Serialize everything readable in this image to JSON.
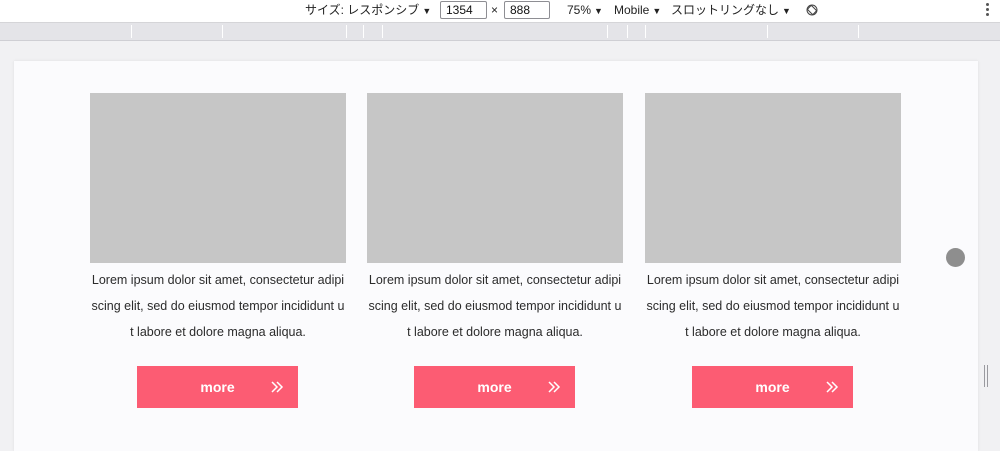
{
  "toolbar": {
    "size_label": "サイズ: レスポンシブ",
    "width_value": "1354",
    "times_sign": "×",
    "height_value": "888",
    "zoom_label": "75%",
    "device_label": "Mobile",
    "throttle_label": "スロットリングなし"
  },
  "cards": [
    {
      "text": "Lorem ipsum dolor sit amet, consectetur adipiscing elit, sed do eiusmod tempor incididunt ut labore et dolore magna aliqua.",
      "button_label": "more"
    },
    {
      "text": "Lorem ipsum dolor sit amet, consectetur adipiscing elit, sed do eiusmod tempor incididunt ut labore et dolore magna aliqua.",
      "button_label": "more"
    },
    {
      "text": "Lorem ipsum dolor sit amet, consectetur adipiscing elit, sed do eiusmod tempor incididunt ut labore et dolore magna aliqua.",
      "button_label": "more"
    }
  ],
  "icons": {
    "caret": "dropdown-caret",
    "rotate": "rotate-icon",
    "menu": "kebab-menu-icon",
    "button": "chevron-double-right-icon"
  },
  "colors": {
    "accent": "#fc5c73",
    "placeholder_image": "#c6c6c6",
    "page_background": "#fbfbfd"
  }
}
